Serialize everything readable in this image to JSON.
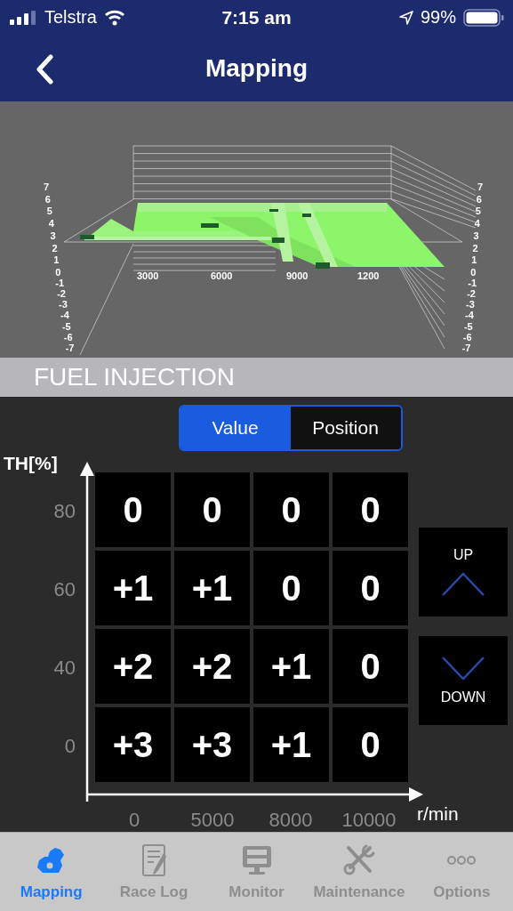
{
  "status_bar": {
    "carrier": "Telstra",
    "time": "7:15 am",
    "battery": "99%"
  },
  "nav_bar": {
    "title": "Mapping"
  },
  "surface_chart": {
    "left_axis_labels": [
      "7",
      "6",
      "5",
      "4",
      "3",
      "2",
      "1",
      "0",
      "-1",
      "-2",
      "-3",
      "-4",
      "-5",
      "-6",
      "-7"
    ],
    "right_axis_labels": [
      "7",
      "6",
      "5",
      "4",
      "3",
      "2",
      "1",
      "0",
      "-1",
      "-2",
      "-3",
      "-4",
      "-5",
      "-6",
      "-7"
    ],
    "x_labels": [
      "3000",
      "6000",
      "9000",
      "1200"
    ]
  },
  "section_title": "FUEL INJECTION",
  "segmented": [
    {
      "label": "Value",
      "selected": true
    },
    {
      "label": "Position",
      "selected": false
    }
  ],
  "map_table": {
    "y_axis_title": "TH[%]",
    "x_axis_title": "r/min",
    "row_labels": [
      "80",
      "60",
      "40",
      "0"
    ],
    "column_labels": [
      "0",
      "5000",
      "8000",
      "10000"
    ],
    "rows": [
      [
        "0",
        "0",
        "0",
        "0"
      ],
      [
        "+1",
        "+1",
        "0",
        "0"
      ],
      [
        "+2",
        "+2",
        "+1",
        "0"
      ],
      [
        "+3",
        "+3",
        "+1",
        "0"
      ]
    ]
  },
  "adjust_buttons": [
    {
      "kind": "up",
      "label": "UP"
    },
    {
      "kind": "down",
      "label": "DOWN"
    }
  ],
  "tabs": [
    {
      "kind": "engine",
      "label": "Mapping",
      "selected": true
    },
    {
      "kind": "notebook",
      "label": "Race Log",
      "selected": false
    },
    {
      "kind": "monitor",
      "label": "Monitor",
      "selected": false
    },
    {
      "kind": "tools",
      "label": "Maintenance",
      "selected": false
    },
    {
      "kind": "more",
      "label": "Options",
      "selected": false
    }
  ]
}
